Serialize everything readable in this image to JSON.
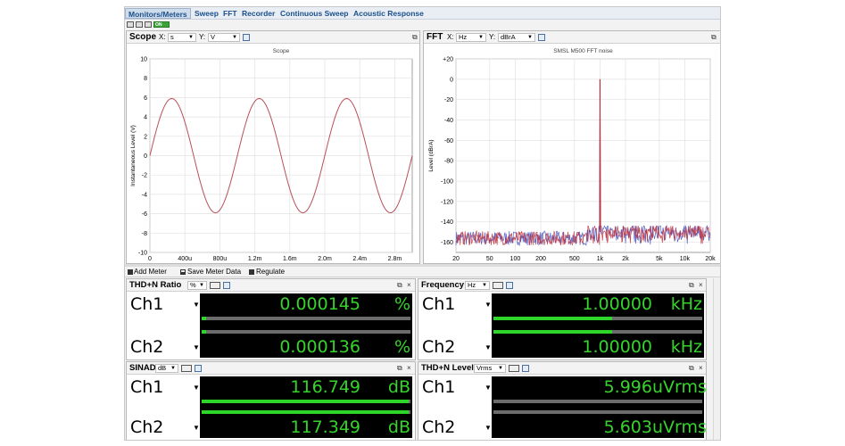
{
  "tabs": [
    "Monitors/Meters",
    "Sweep",
    "FFT",
    "Recorder",
    "Continuous Sweep",
    "Acoustic Response"
  ],
  "toolbar": {
    "on_label": "ON"
  },
  "scope": {
    "title": "Scope",
    "x_label": "X:",
    "x_unit": "s",
    "y_label": "Y:",
    "y_unit": "V"
  },
  "fft": {
    "title": "FFT",
    "x_label": "X:",
    "x_unit": "Hz",
    "y_label": "Y:",
    "y_unit": "dBrA"
  },
  "chart_data": [
    {
      "type": "line",
      "title": "Scope",
      "xlabel": "Time (s)",
      "ylabel": "Instantaneous Level (V)",
      "xlim": [
        0,
        0.003
      ],
      "ylim": [
        -10,
        10
      ],
      "x_ticks": [
        "0",
        "400u",
        "800u",
        "1.2m",
        "1.6m",
        "2.0m",
        "2.4m",
        "2.8m"
      ],
      "y_ticks": [
        "10",
        "8",
        "6",
        "4",
        "2",
        "0",
        "-2",
        "-4",
        "-6",
        "-8",
        "-10"
      ],
      "series": [
        {
          "name": "",
          "frequency_hz": 1000,
          "amplitude_v": 5.9,
          "phase_start": "0 V rising at t=0"
        }
      ],
      "grid": true
    },
    {
      "type": "line",
      "title": "SMSL M500 FFT noise",
      "xlabel": "Frequency (Hz)",
      "ylabel": "Level (dBrA)",
      "xscale": "log",
      "xlim": [
        20,
        20000
      ],
      "ylim": [
        -170,
        20
      ],
      "x_ticks": [
        "20",
        "50",
        "100",
        "200",
        "500",
        "1k",
        "2k",
        "5k",
        "10k",
        "20k"
      ],
      "y_ticks": [
        "+20",
        "0",
        "-20",
        "-40",
        "-60",
        "-80",
        "-100",
        "-120",
        "-140",
        "-160"
      ],
      "series": [
        {
          "name": "Ch1",
          "color": "#3b4cc0",
          "noise_floor_db": -156,
          "peak": {
            "x": 1000,
            "y": 0
          }
        },
        {
          "name": "Ch2",
          "color": "#c0303a",
          "noise_floor_db": -156,
          "peak": {
            "x": 1000,
            "y": 0
          }
        }
      ],
      "grid": true
    }
  ],
  "meter_toolbar": {
    "add_meter": "Add Meter",
    "save_meter_data": "Save Meter Data",
    "regulate": "Regulate"
  },
  "meters": [
    {
      "title": "THD+N Ratio",
      "unit_option": "%",
      "channels": [
        {
          "label": "Ch1",
          "value": "0.000145",
          "unit": "%",
          "bar_fraction": 0.02
        },
        {
          "label": "Ch2",
          "value": "0.000136",
          "unit": "%",
          "bar_fraction": 0.02
        }
      ]
    },
    {
      "title": "Frequency",
      "unit_option": "Hz",
      "channels": [
        {
          "label": "Ch1",
          "value": "1.00000",
          "unit": "kHz",
          "bar_fraction": 0.57
        },
        {
          "label": "Ch2",
          "value": "1.00000",
          "unit": "kHz",
          "bar_fraction": 0.57
        }
      ]
    },
    {
      "title": "SINAD",
      "unit_option": "dB",
      "channels": [
        {
          "label": "Ch1",
          "value": "116.749",
          "unit": "dB",
          "bar_fraction": 0.99
        },
        {
          "label": "Ch2",
          "value": "117.349",
          "unit": "dB",
          "bar_fraction": 0.99
        }
      ]
    },
    {
      "title": "THD+N Level",
      "unit_option": "Vrms",
      "channels": [
        {
          "label": "Ch1",
          "value": "5.996",
          "unit": "uVrms",
          "bar_fraction": 0.0
        },
        {
          "label": "Ch2",
          "value": "5.603",
          "unit": "uVrms",
          "bar_fraction": 0.0
        }
      ]
    }
  ]
}
